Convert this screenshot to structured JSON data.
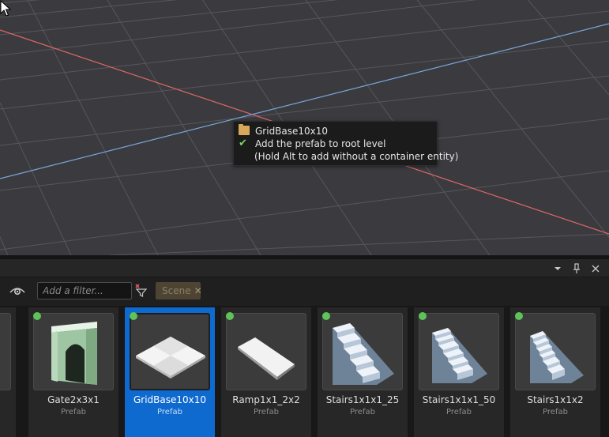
{
  "tooltip": {
    "title": "GridBase10x10",
    "line1": "Add the prefab to root level",
    "line2": "(Hold Alt to add without a container entity)",
    "folder_icon": "folder-icon",
    "check_icon": "check-icon"
  },
  "panel_header": {
    "menu_icon": "dropdown-arrow-icon",
    "pin_icon": "pin-icon",
    "close_icon": "close-icon"
  },
  "toolbar": {
    "visibility_icon": "eye-icon",
    "filter_placeholder": "Add a filter...",
    "filter_clear_icon": "filter-clear-icon",
    "scene_tag": "Scene"
  },
  "assets": [
    {
      "name": "",
      "type": "",
      "icon": "partial-prefab-thumbnail"
    },
    {
      "name": "Gate2x3x1",
      "type": "Prefab",
      "icon": "gate-thumbnail"
    },
    {
      "name": "GridBase10x10",
      "type": "Prefab",
      "icon": "grid-base-thumbnail",
      "selected": true
    },
    {
      "name": "Ramp1x1_2x2",
      "type": "Prefab",
      "icon": "ramp-thumbnail"
    },
    {
      "name": "Stairs1x1x1_25",
      "type": "Prefab",
      "icon": "stairs-thumbnail"
    },
    {
      "name": "Stairs1x1x1_50",
      "type": "Prefab",
      "icon": "stairs-thumbnail"
    },
    {
      "name": "Stairs1x1x2",
      "type": "Prefab",
      "icon": "stairs-thumbnail"
    }
  ],
  "colors": {
    "viewport_bg": "#3a3a3f",
    "selection": "#0f6ad0",
    "x_axis": "#e26b6b",
    "z_axis": "#7aa6d8",
    "status_dot": "#5fc35a",
    "scene_tag_bg": "#4d4434"
  }
}
